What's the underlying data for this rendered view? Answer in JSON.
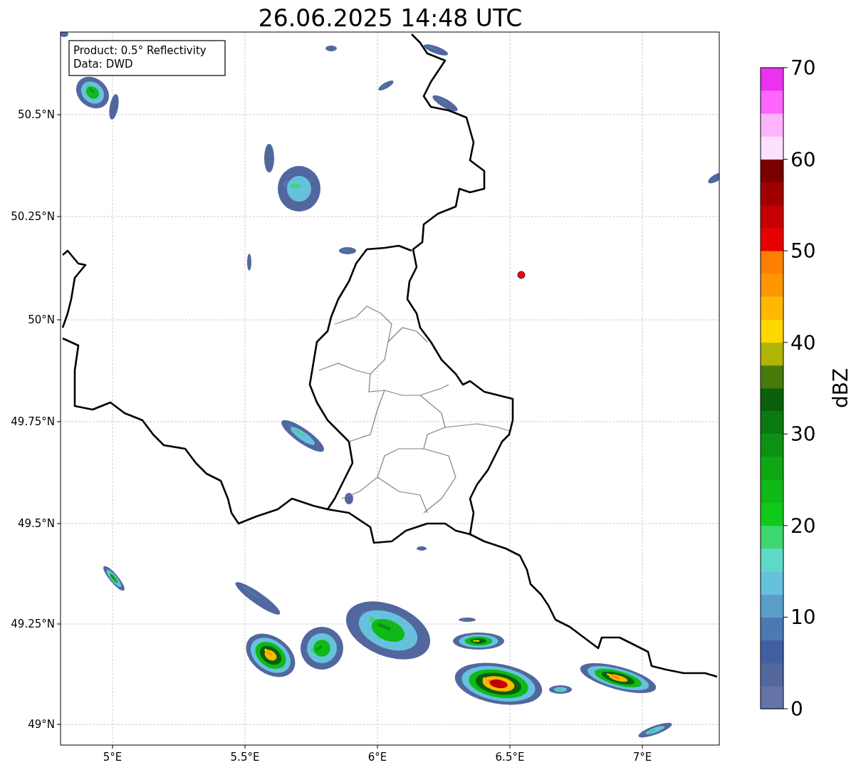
{
  "title": "26.06.2025 14:48 UTC",
  "info_box": [
    "Product: 0.5° Reflectivity",
    "Data: DWD"
  ],
  "x_ticks": [
    "5°E",
    "5.5°E",
    "6°E",
    "6.5°E",
    "7°E"
  ],
  "y_ticks": [
    "50.5°N",
    "50.25°N",
    "50°N",
    "49.75°N",
    "49.5°N",
    "49.25°N",
    "49°N"
  ],
  "location_marker": {
    "color": "#ff0000"
  },
  "colorbar": {
    "label": "dBZ",
    "ticks": [
      "70",
      "60",
      "50",
      "40",
      "30",
      "20",
      "10",
      "0"
    ],
    "bands": [
      {
        "color": "#6474a8"
      },
      {
        "color": "#52679e"
      },
      {
        "color": "#425fa3"
      },
      {
        "color": "#4b7ab3"
      },
      {
        "color": "#5a9ec8"
      },
      {
        "color": "#66c2dc"
      },
      {
        "color": "#5ed8c7"
      },
      {
        "color": "#3ed670"
      },
      {
        "color": "#11c91a"
      },
      {
        "color": "#10b818"
      },
      {
        "color": "#0ea713"
      },
      {
        "color": "#0c9112"
      },
      {
        "color": "#0a7a10"
      },
      {
        "color": "#08600d"
      },
      {
        "color": "#477a0a"
      },
      {
        "color": "#b0b406"
      },
      {
        "color": "#ffd700"
      },
      {
        "color": "#ffb800"
      },
      {
        "color": "#ff9800"
      },
      {
        "color": "#ff7f00"
      },
      {
        "color": "#e60000"
      },
      {
        "color": "#c40000"
      },
      {
        "color": "#a00000"
      },
      {
        "color": "#7a0000"
      },
      {
        "color": "#ffe0ff"
      },
      {
        "color": "#ffb3ff"
      },
      {
        "color": "#ff66ff"
      },
      {
        "color": "#e933ee"
      }
    ]
  }
}
